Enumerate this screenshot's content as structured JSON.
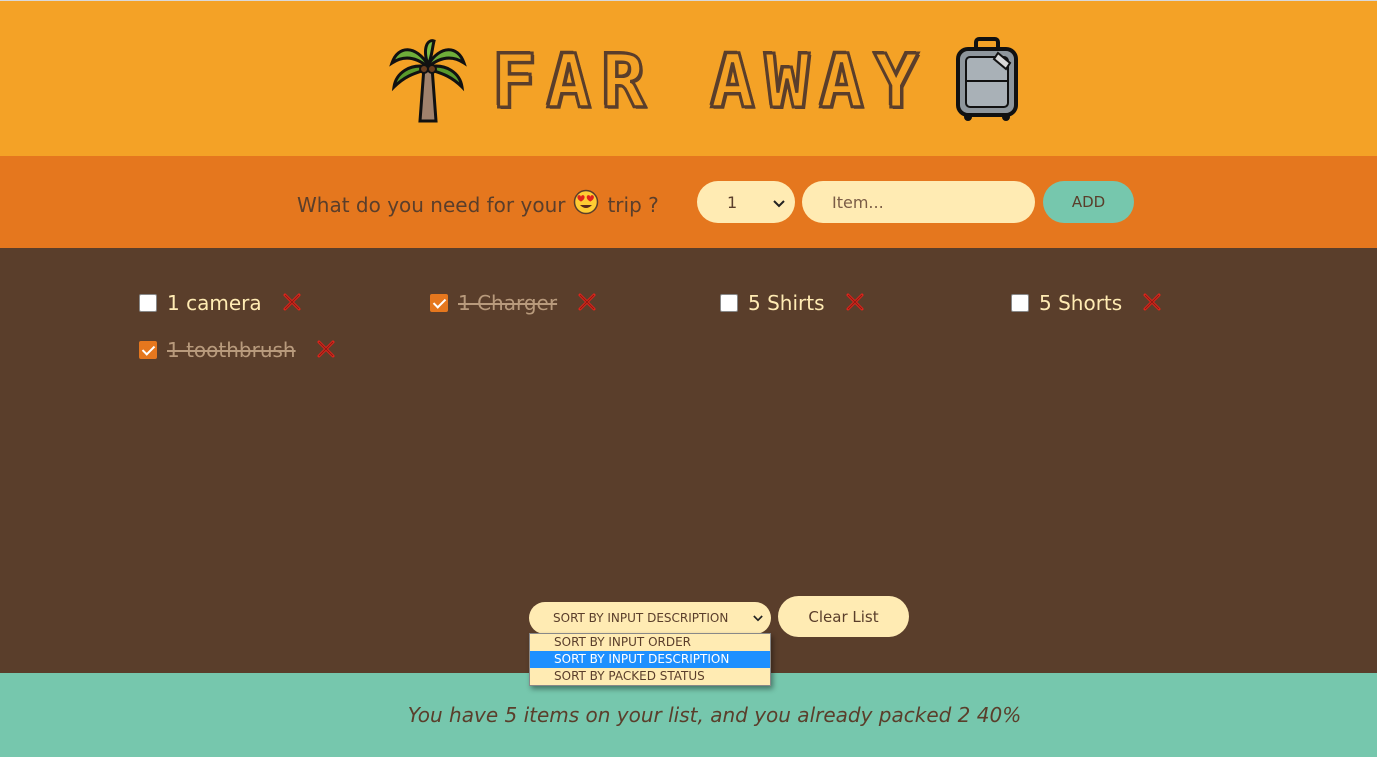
{
  "header": {
    "title": "FAR AWAY",
    "left_icon": "palm-tree-icon",
    "right_icon": "luggage-icon"
  },
  "form": {
    "label_before": "What do you need for your",
    "label_emoji": "😍",
    "label_after": "trip ?",
    "quantity_value": "1",
    "item_placeholder": "Item...",
    "add_label": "ADD"
  },
  "items": [
    {
      "text": "1 camera",
      "packed": false
    },
    {
      "text": "1 Charger",
      "packed": true
    },
    {
      "text": "5 Shirts",
      "packed": false
    },
    {
      "text": "5 Shorts",
      "packed": false
    },
    {
      "text": "1 toothbrush",
      "packed": true
    }
  ],
  "actions": {
    "sort_selected": "SORT BY INPUT DESCRIPTION",
    "sort_options": [
      "SORT BY INPUT ORDER",
      "SORT BY INPUT DESCRIPTION",
      "SORT BY PACKED STATUS"
    ],
    "clear_label": "Clear List"
  },
  "footer": {
    "stats": "You have 5 items on your list, and you already packed 2 40%"
  },
  "colors": {
    "header_bg": "#f4a226",
    "form_bg": "#e5771e",
    "list_bg": "#5a3e2b",
    "footer_bg": "#76c7ad",
    "input_bg": "#ffebb3",
    "delete_icon": "#e0241b"
  }
}
